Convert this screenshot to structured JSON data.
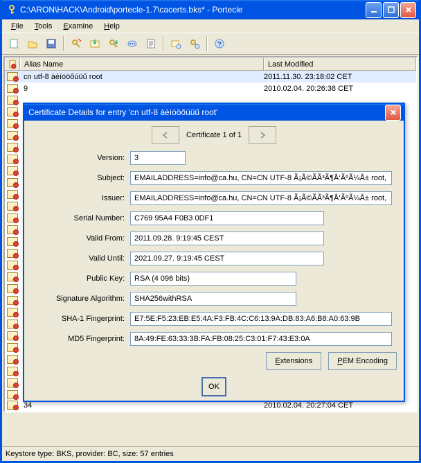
{
  "window": {
    "title": "C:\\ARON\\HACK\\Android\\portecle-1.7\\cacerts.bks* - Portecle"
  },
  "menu": {
    "file": "File",
    "tools": "Tools",
    "examine": "Examine",
    "help": "Help"
  },
  "table": {
    "header_name": "Alias Name",
    "header_mod": "Last Modified",
    "rows": [
      {
        "name": "cn utf-8 áéíóöőúüű root",
        "mod": "2011.11.30. 23:18:02 CET"
      },
      {
        "name": "9",
        "mod": "2010.02.04. 20:26:38 CET"
      }
    ],
    "bottom_row": {
      "name": "34",
      "mod": "2010.02.04. 20:27:04 CET"
    }
  },
  "dialog": {
    "title": "Certificate Details for entry 'cn utf-8 áéíóöőúüű root'",
    "nav_text": "Certificate 1 of 1",
    "fields": {
      "version_label": "Version:",
      "version": "3",
      "subject_label": "Subject:",
      "subject": "EMAILADDRESS=info@ca.hu, CN=CN UTF-8 Ã¡Ã©Ã­Ã³Ã¶Å‘ÃºÃ¼Å± root,",
      "issuer_label": "Issuer:",
      "issuer": "EMAILADDRESS=info@ca.hu, CN=CN UTF-8 Ã¡Ã©Ã­Ã³Ã¶Å‘ÃºÃ¼Å± root,",
      "serial_label": "Serial Number:",
      "serial": "C769 95A4 F0B3 0DF1",
      "valid_from_label": "Valid From:",
      "valid_from": "2011.09.28. 9:19:45 CEST",
      "valid_until_label": "Valid Until:",
      "valid_until": "2021.09.27. 9:19:45 CEST",
      "pubkey_label": "Public Key:",
      "pubkey": "RSA (4 096 bits)",
      "sigalg_label": "Signature Algorithm:",
      "sigalg": "SHA256withRSA",
      "sha1_label": "SHA-1 Fingerprint:",
      "sha1": "E7:5E:F5:23:EB:E5:4A:F3:FB:4C:C6:13:9A:DB:83:A6:B8:A0:63:9B",
      "md5_label": "MD5 Fingerprint:",
      "md5": "8A:49:FE:63:33:3B:FA:FB:08:25:C3:01:F7:43:E3:0A"
    },
    "buttons": {
      "extensions": "Extensions",
      "pem": "PEM Encoding",
      "ok": "OK"
    }
  },
  "statusbar": {
    "text": "Keystore type: BKS, provider: BC, size: 57 entries"
  }
}
